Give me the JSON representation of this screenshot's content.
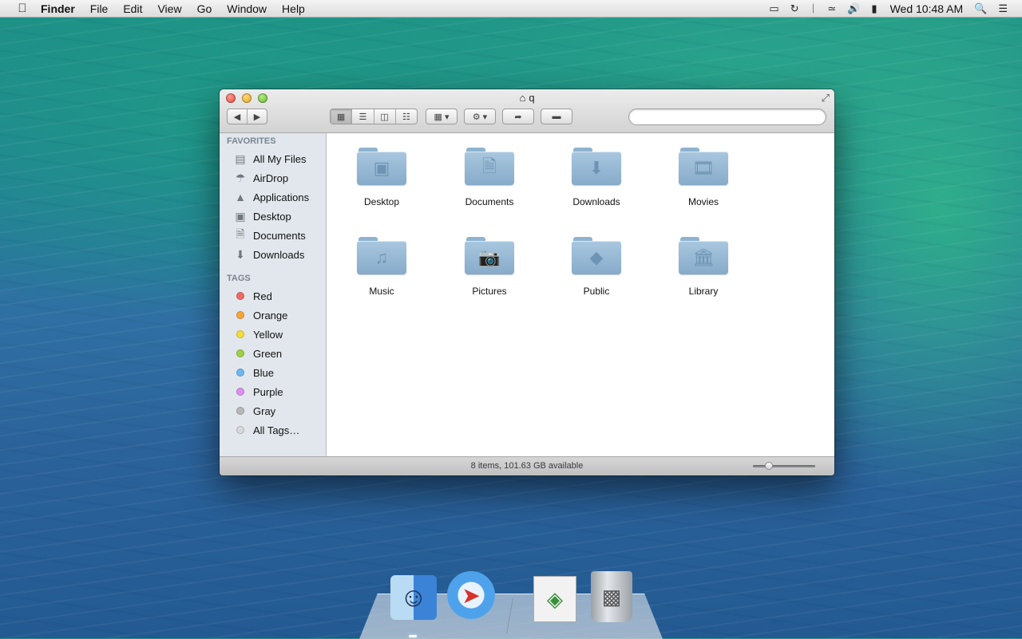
{
  "menubar": {
    "apple_glyph": "",
    "app_name": "Finder",
    "menus": [
      "File",
      "Edit",
      "View",
      "Go",
      "Window",
      "Help"
    ],
    "status_icons": [
      "airplay-icon",
      "time-machine-icon",
      "bluetooth-icon",
      "wifi-icon",
      "volume-icon",
      "battery-icon"
    ],
    "clock": "Wed 10:48 AM"
  },
  "window": {
    "title": "q",
    "search": {
      "placeholder": "",
      "value": ""
    },
    "view_modes": [
      "icon-view",
      "list-view",
      "column-view",
      "cover-flow-view"
    ],
    "active_view": "icon-view"
  },
  "sidebar": {
    "favorites_header": "FAVORITES",
    "favorites": [
      {
        "label": "All My Files",
        "icon": "all-my-files-icon"
      },
      {
        "label": "AirDrop",
        "icon": "airdrop-icon"
      },
      {
        "label": "Applications",
        "icon": "applications-icon"
      },
      {
        "label": "Desktop",
        "icon": "desktop-icon"
      },
      {
        "label": "Documents",
        "icon": "documents-icon"
      },
      {
        "label": "Downloads",
        "icon": "downloads-icon"
      }
    ],
    "tags_header": "TAGS",
    "tags": [
      {
        "label": "Red",
        "color": "#f06a64"
      },
      {
        "label": "Orange",
        "color": "#f7a53b"
      },
      {
        "label": "Yellow",
        "color": "#f5dc38"
      },
      {
        "label": "Green",
        "color": "#9ed047"
      },
      {
        "label": "Blue",
        "color": "#6bb7ef"
      },
      {
        "label": "Purple",
        "color": "#e08ff0"
      },
      {
        "label": "Gray",
        "color": "#b8b8b8"
      },
      {
        "label": "All Tags…",
        "color": "#d8d8d8"
      }
    ]
  },
  "content": {
    "items": [
      {
        "label": "Desktop",
        "icon": "desktop-folder-icon"
      },
      {
        "label": "Documents",
        "icon": "documents-folder-icon"
      },
      {
        "label": "Downloads",
        "icon": "downloads-folder-icon"
      },
      {
        "label": "Movies",
        "icon": "movies-folder-icon"
      },
      {
        "label": "Music",
        "icon": "music-folder-icon"
      },
      {
        "label": "Pictures",
        "icon": "pictures-folder-icon"
      },
      {
        "label": "Public",
        "icon": "public-folder-icon"
      },
      {
        "label": "Library",
        "icon": "library-folder-icon"
      }
    ]
  },
  "statusbar": {
    "text": "8 items, 101.63 GB available",
    "icon_size_fraction": 0.25
  },
  "dock": {
    "apps": [
      "finder-icon",
      "safari-icon",
      "preview-icon",
      "trash-icon"
    ]
  },
  "colors": {
    "accent": "#3b83d6",
    "sidebar_bg": "#e2e7ed",
    "folder_blue": "#a9c7df"
  }
}
